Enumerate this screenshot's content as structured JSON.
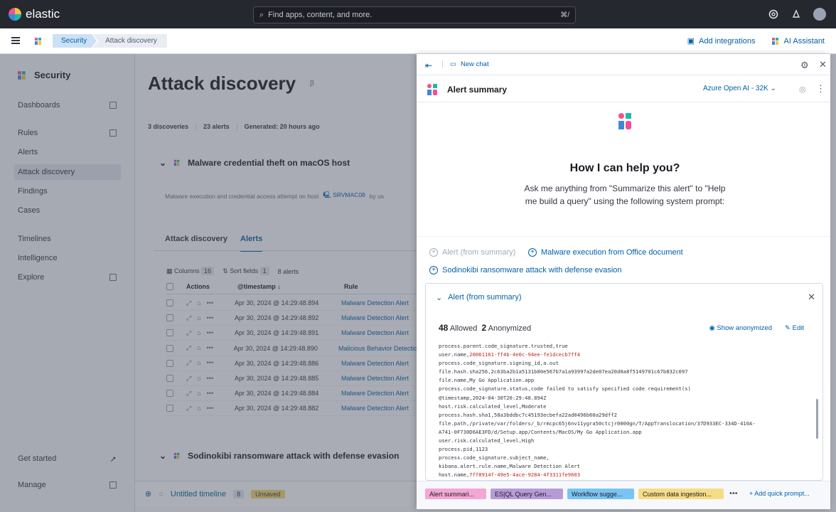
{
  "topbar": {
    "brand": "elastic",
    "search_placeholder": "Find apps, content, and more.",
    "search_shortcut": "⌘/",
    "icons": [
      "help-icon",
      "newsfeed-icon",
      "user-avatar"
    ]
  },
  "subbar": {
    "breadcrumbs": [
      "Security",
      "Attack discovery"
    ],
    "add_integrations": "Add integrations",
    "ai_assistant": "AI Assistant"
  },
  "sidenav": {
    "heading": "Security",
    "items": [
      "Dashboards",
      "Rules",
      "Alerts",
      "Attack discovery",
      "Findings",
      "Cases",
      "Timelines",
      "Intelligence",
      "Explore"
    ],
    "active": "Attack discovery",
    "get_started": "Get started",
    "manage": "Manage"
  },
  "page": {
    "title": "Attack discovery",
    "beta_icon": "beta-icon",
    "meta": [
      "3 discoveries",
      "23 alerts",
      "Generated: 20 hours ago"
    ],
    "card1_title": "Malware credential theft on macOS host",
    "card1_desc": "Malware execution and credential access attempt on host",
    "card1_host": "SRVMAC08",
    "card1_desc_tail": "by us",
    "tabs": [
      "Attack discovery",
      "Alerts"
    ],
    "columns_label": "Columns",
    "columns_count": "16",
    "sort_label": "Sort fields",
    "sort_count": "1",
    "alerts_count": "8 alerts",
    "headers": [
      "Actions",
      "@timestamp",
      "Rule"
    ],
    "rows": [
      {
        "ts": "Apr 30, 2024 @ 14:29:48.894",
        "rule": "Malware Detection Alert"
      },
      {
        "ts": "Apr 30, 2024 @ 14:29:48.892",
        "rule": "Malware Detection Alert"
      },
      {
        "ts": "Apr 30, 2024 @ 14:29:48.891",
        "rule": "Malware Detection Alert"
      },
      {
        "ts": "Apr 30, 2024 @ 14:29:48.890",
        "rule": "Malicious Behavior Detection"
      },
      {
        "ts": "Apr 30, 2024 @ 14:29:48.886",
        "rule": "Malware Detection Alert"
      },
      {
        "ts": "Apr 30, 2024 @ 14:29:48.885",
        "rule": "Malware Detection Alert"
      },
      {
        "ts": "Apr 30, 2024 @ 14:29:48.884",
        "rule": "Malware Detection Alert"
      },
      {
        "ts": "Apr 30, 2024 @ 14:29:48.882",
        "rule": "Malware Detection Alert"
      }
    ],
    "card2_title": "Sodinokibi ransomware attack with defense evasion"
  },
  "timeline": {
    "label": "Untitled timeline",
    "count": "8",
    "status": "Unsaved"
  },
  "flyout": {
    "new_chat": "New chat",
    "title": "Alert summary",
    "connector": "Azure Open AI - 32K",
    "help_title": "How I can help you?",
    "help_text": "Ask me anything from \"Summarize this alert\" to \"Help me build a query\" using the following system prompt:",
    "prompts": [
      "Alert (from summary)",
      "Malware execution from Office document",
      "Sodinokibi ransomware attack with defense evasion"
    ],
    "panel_title": "Alert (from summary)",
    "allowed_count": "48",
    "allowed_label": "Allowed",
    "anon_count": "2",
    "anon_label": "Anonymized",
    "show_anonymized": "Show anonymized",
    "edit": "Edit",
    "code_lines": [
      {
        "k": "process.parent.code_signature.trusted,",
        "v": "true",
        "anon": false
      },
      {
        "k": "user.name,",
        "v": "20061161-ff4b-4e0c-94ee-fe1dcecb7ff4",
        "anon": true
      },
      {
        "k": "process.code_signature.signing_id,",
        "v": "a.out",
        "anon": false
      },
      {
        "k": "file.hash.sha256,",
        "v": "2c63ba2b1a5131b80e567b7a1a93997a2de07ea20d0a8f5149701c67b832c097",
        "anon": false
      },
      {
        "k": "file.name,",
        "v": "My Go Application.app",
        "anon": false
      },
      {
        "k": "process.code_signature.status,",
        "v": "code failed to satisfy specified code requirement(s)",
        "anon": false
      },
      {
        "k": "@timestamp,",
        "v": "2024-04-30T20:29:48.894Z",
        "anon": false
      },
      {
        "k": "host.risk.calculated_level,",
        "v": "Moderate",
        "anon": false
      },
      {
        "k": "process.hash.sha1,",
        "v": "58a3bddbc7c45193ecbefa22ad0496b60a29dff2",
        "anon": false
      },
      {
        "k": "file.path,",
        "v": "/private/var/folders/_b/rmcpc65j6nv11ygra50ctcjr0000gn/T/AppTranslocation/37D933EC-334D-410A-",
        "anon": false
      },
      {
        "k": "",
        "v": "A741-0F730D6AE3FD/d/Setup.app/Contents/MacOS/My Go Application.app",
        "anon": false
      },
      {
        "k": "user.risk.calculated_level,",
        "v": "High",
        "anon": false
      },
      {
        "k": "process.pid,",
        "v": "1123",
        "anon": false
      },
      {
        "k": "process.code_signature.subject_name,",
        "v": "",
        "anon": false
      },
      {
        "k": "kibana.alert.rule.name,",
        "v": "Malware Detection Alert",
        "anon": false
      },
      {
        "k": "host.name,",
        "v": "7ff8914f-49e5-4ace-9284-4f3311fe9603",
        "anon": true
      }
    ],
    "quick_prompts": [
      {
        "label": "Alert summari...",
        "color": "#f4a6d4"
      },
      {
        "label": "ES|QL Query Gen...",
        "color": "#b79bd9"
      },
      {
        "label": "Workflow sugge...",
        "color": "#79c4f5"
      },
      {
        "label": "Custom data ingestion...",
        "color": "#f6dc85"
      }
    ],
    "more": "•••",
    "add_quick_prompt": "Add quick prompt..."
  }
}
